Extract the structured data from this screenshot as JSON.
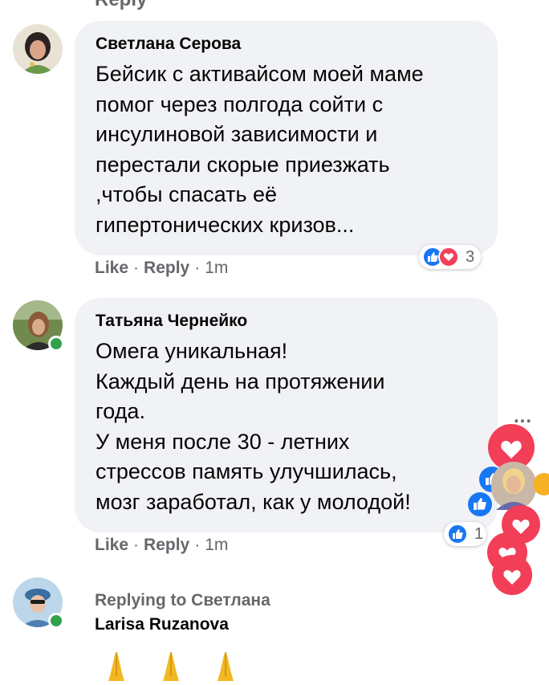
{
  "top_partial": {
    "reply_label": "Reply"
  },
  "comments": [
    {
      "author": "Светлана Серова",
      "text": "Бейсик с активайсом моей маме\nпомог через полгода сойти с\nинсулиновой зависимости и\nперестали скорые приезжать\n,чтобы спасать её\nгипертонических кризов...",
      "actions": {
        "like": "Like",
        "reply": "Reply",
        "time": "1m",
        "sep": "·"
      },
      "reaction_count": "3",
      "reactions": [
        "like-icon",
        "love-icon"
      ],
      "online": false
    },
    {
      "author": "Татьяна Чернейко",
      "text": "Омега уникальная!\nКаждый день на протяжении\nгода.\nУ меня после 30 - летних\nстрессов память улучшилась,\nмозг заработал, как у молодой!",
      "actions": {
        "like": "Like",
        "reply": "Reply",
        "time": "1m",
        "sep": "·"
      },
      "reaction_count": "1",
      "reactions": [
        "like-icon"
      ],
      "online": true
    }
  ],
  "reply": {
    "replying_to": "Replying to Светлана",
    "author": "Larisa Ruzanova",
    "content": "🙏🙏🙏",
    "online": true
  },
  "more_options": "...",
  "colors": {
    "bubble": "#f0f2f5",
    "like_blue": "#1877f2",
    "love_red": "#f33e58",
    "online_green": "#31a24c",
    "meta_gray": "#65676b"
  }
}
